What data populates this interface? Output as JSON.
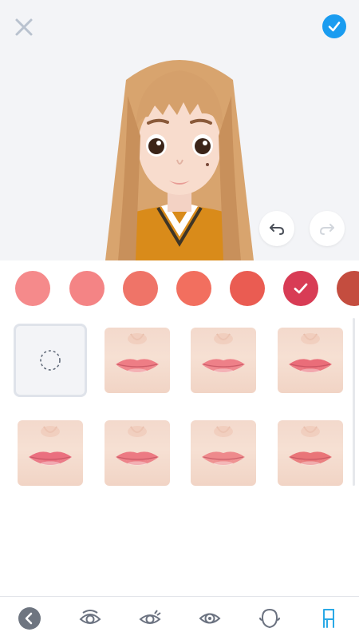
{
  "header": {
    "close_icon": "close-icon",
    "confirm_icon": "checkmark-icon",
    "accent_color": "#1a9cf0"
  },
  "history": {
    "undo_icon": "undo-icon",
    "redo_icon": "redo-icon",
    "redo_enabled": false
  },
  "lip_colors": {
    "selected_index": 5,
    "swatches": [
      "#f58a8b",
      "#f48485",
      "#ef7468",
      "#f26f5f",
      "#ea5c52",
      "#d83c55",
      "#c44d3f"
    ]
  },
  "lip_styles": {
    "selected_index": 0,
    "items": [
      {
        "kind": "none",
        "icon": "dashed-circle-icon"
      },
      {
        "kind": "lip",
        "color": "#ee7d85"
      },
      {
        "kind": "lip",
        "color": "#ee8088"
      },
      {
        "kind": "lip",
        "color": "#ea6d79"
      },
      {
        "kind": "lip",
        "color": "#ea707f"
      },
      {
        "kind": "lip",
        "color": "#ec7a83"
      },
      {
        "kind": "lip",
        "color": "#ee8a8c"
      },
      {
        "kind": "lip",
        "color": "#e97578"
      }
    ]
  },
  "tab_bar": {
    "active_index": 5,
    "items": [
      "back-icon",
      "eye-shape-icon",
      "eyelash-icon",
      "eye-color-icon",
      "face-shape-icon",
      "chair-icon"
    ],
    "active_color": "#2aa9e6",
    "inactive_color": "#6b7280"
  }
}
